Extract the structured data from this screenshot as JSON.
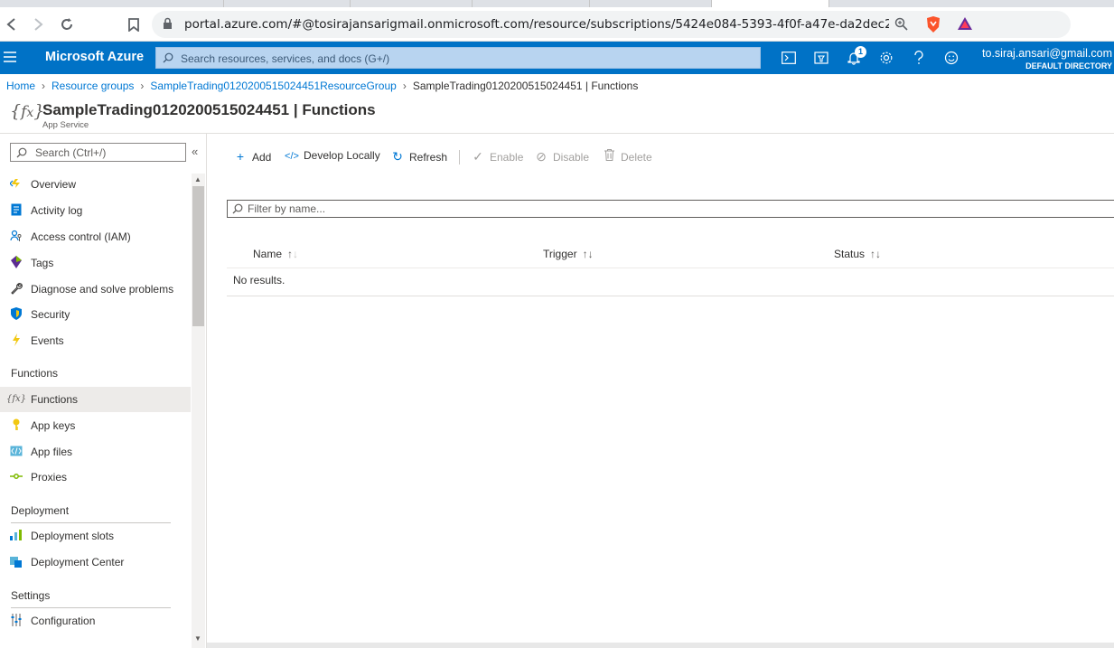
{
  "browser": {
    "url": "portal.azure.com/#@tosirajansarigmail.onmicrosoft.com/resource/subscriptions/5424e084-5393-4f0f-a47e-da2dec2e866c/r..."
  },
  "header": {
    "brand": "Microsoft Azure",
    "search_placeholder": "Search resources, services, and docs (G+/)",
    "notification_count": "1",
    "user_email": "to.siraj.ansari@gmail.com",
    "directory": "DEFAULT DIRECTORY"
  },
  "breadcrumb": [
    "Home",
    "Resource groups",
    "SampleTrading0120200515024451ResourceGroup",
    "SampleTrading0120200515024451 | Functions"
  ],
  "page": {
    "title": "SampleTrading0120200515024451 | Functions",
    "subtitle": "App Service"
  },
  "sidebar": {
    "search_placeholder": "Search (Ctrl+/)",
    "items": [
      {
        "label": "Overview"
      },
      {
        "label": "Activity log"
      },
      {
        "label": "Access control (IAM)"
      },
      {
        "label": "Tags"
      },
      {
        "label": "Diagnose and solve problems"
      },
      {
        "label": "Security"
      },
      {
        "label": "Events"
      }
    ],
    "sections": [
      {
        "title": "Functions",
        "items": [
          {
            "label": "Functions"
          },
          {
            "label": "App keys"
          },
          {
            "label": "App files"
          },
          {
            "label": "Proxies"
          }
        ]
      },
      {
        "title": "Deployment",
        "items": [
          {
            "label": "Deployment slots"
          },
          {
            "label": "Deployment Center"
          }
        ]
      },
      {
        "title": "Settings",
        "items": [
          {
            "label": "Configuration"
          }
        ]
      }
    ]
  },
  "toolbar": {
    "add": "Add",
    "develop_locally": "Develop Locally",
    "refresh": "Refresh",
    "enable": "Enable",
    "disable": "Disable",
    "delete": "Delete"
  },
  "filter_placeholder": "Filter by name...",
  "table": {
    "columns": [
      "Name",
      "Trigger",
      "Status"
    ],
    "empty_message": "No results."
  },
  "colors": {
    "azure_blue": "#0072c6",
    "link": "#0078d4"
  }
}
